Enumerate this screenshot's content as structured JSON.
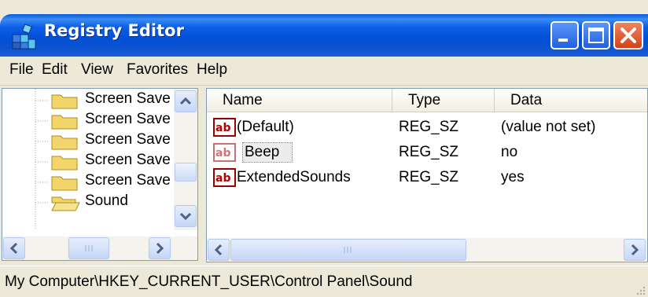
{
  "window": {
    "title": "Registry Editor"
  },
  "menu": {
    "items": [
      "File",
      "Edit",
      "View",
      "Favorites",
      "Help"
    ]
  },
  "tree": {
    "items": [
      {
        "label": "Screen Save",
        "icon": "folder-icon"
      },
      {
        "label": "Screen Save",
        "icon": "folder-icon"
      },
      {
        "label": "Screen Save",
        "icon": "folder-icon"
      },
      {
        "label": "Screen Save",
        "icon": "folder-icon"
      },
      {
        "label": "Screen Save",
        "icon": "folder-icon"
      },
      {
        "label": "Sound",
        "icon": "open-folder-icon",
        "selected": true
      }
    ]
  },
  "list": {
    "columns": [
      "Name",
      "Type",
      "Data"
    ],
    "rows": [
      {
        "name": "(Default)",
        "type": "REG_SZ",
        "data": "(value not set)"
      },
      {
        "name": "Beep",
        "type": "REG_SZ",
        "data": "no",
        "focused": true
      },
      {
        "name": "ExtendedSounds",
        "type": "REG_SZ",
        "data": "yes"
      }
    ]
  },
  "status": {
    "path": "My Computer\\HKEY_CURRENT_USER\\Control Panel\\Sound"
  },
  "colors": {
    "titlebar": "#0351d9",
    "close": "#d3431a",
    "chrome": "#ece9d8",
    "pane_border": "#7f9db9"
  }
}
